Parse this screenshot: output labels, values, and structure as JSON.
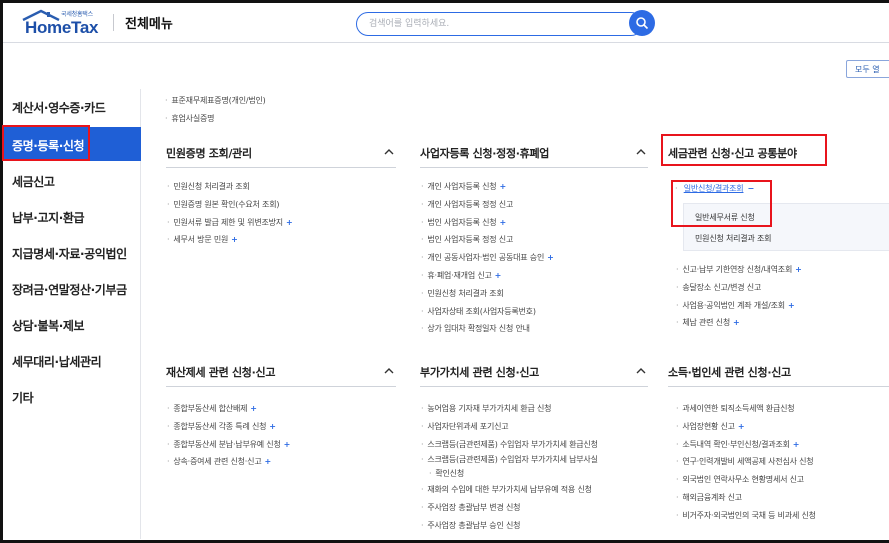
{
  "header": {
    "logo_subtitle": "국세청홈택스",
    "logo_text": "HomeTax",
    "menu_title": "전체메뉴",
    "search_placeholder": "검색어를 입력하세요.",
    "all_button": "모두 열"
  },
  "sidebar": {
    "items": [
      {
        "label": "계산서·영수증·카드"
      },
      {
        "label": "증명·등록·신청"
      },
      {
        "label": "세금신고"
      },
      {
        "label": "납부·고지·환급"
      },
      {
        "label": "지급명세·자료·공익법인"
      },
      {
        "label": "장려금·연말정산·기부금"
      },
      {
        "label": "상담·불복·제보"
      },
      {
        "label": "세무대리·납세관리"
      },
      {
        "label": "기타"
      }
    ],
    "active_index": 1
  },
  "top_items": [
    "표준재무제표증명(개인/법인)",
    "휴업사실증명"
  ],
  "sections": {
    "civil": {
      "title": "민원증명 조회/관리",
      "items": [
        {
          "label": "민원신청 처리결과 조회",
          "plus": ""
        },
        {
          "label": "민원증명 원본 확인(수요처 조회)",
          "plus": ""
        },
        {
          "label": "민원서류 발급 제한 및 위변조방지",
          "plus": "+"
        },
        {
          "label": "세무서 방문 민원",
          "plus": "+"
        }
      ]
    },
    "business": {
      "title": "사업자등록 신청·정정·휴폐업",
      "items": [
        {
          "label": "개인 사업자등록 신청",
          "plus": "+"
        },
        {
          "label": "개인 사업자등록 정정 신고",
          "plus": ""
        },
        {
          "label": "법인 사업자등록 신청",
          "plus": "+"
        },
        {
          "label": "법인 사업자등록 정정 신고",
          "plus": ""
        },
        {
          "label": "개인 공동사업자·법인 공동대표 승인",
          "plus": "+"
        },
        {
          "label": "휴·폐업·재개업 신고",
          "plus": "+"
        },
        {
          "label": "민원신청 처리결과 조회",
          "plus": ""
        },
        {
          "label": "사업자상태 조회(사업자등록번호)",
          "plus": ""
        },
        {
          "label": "상가 임대차 확정일자 신청 안내",
          "plus": ""
        }
      ]
    },
    "common": {
      "title": "세금관련 신청·신고 공통분야",
      "expanded_label": "일반신청/결과조회",
      "expanded_sign": "−",
      "sub_items": [
        "일반세무서류 신청",
        "민원신청 처리결과 조회"
      ],
      "items": [
        {
          "label": "신고·납부 기한연장 신청/내역조회",
          "plus": "+"
        },
        {
          "label": "송달장소 신고/변경 신고",
          "plus": ""
        },
        {
          "label": "사업용·공익법인 계좌 개설/조회",
          "plus": "+"
        },
        {
          "label": "체납 관련 신청",
          "plus": "+"
        }
      ]
    },
    "property": {
      "title": "재산제세 관련 신청·신고",
      "items": [
        {
          "label": "종합부동산세 합산배제",
          "plus": "+"
        },
        {
          "label": "종합부동산세 각종 특례 신청",
          "plus": "+"
        },
        {
          "label": "종합부동산세 분납·납부유예 신청",
          "plus": "+"
        },
        {
          "label": "상속·증여세 관련 신청·신고",
          "plus": "+"
        }
      ]
    },
    "vat": {
      "title": "부가가치세 관련 신청·신고",
      "items": [
        {
          "label": "농어업용 기자재 부가가치세 환급 신청",
          "plus": ""
        },
        {
          "label": "사업자단위과세 포기신고",
          "plus": ""
        },
        {
          "label": "스크랩등(금관련제품) 수입업자 부가가치세 환급신청",
          "plus": ""
        },
        {
          "label": "스크랩등(금관련제품) 수입업자 부가가치세 납부사실",
          "plus": ""
        },
        {
          "label": "확인신청",
          "plus": "",
          "nobullet": true
        },
        {
          "label": "재화의 수입에 대한 부가가치세 납부유예 적용 신청",
          "plus": ""
        },
        {
          "label": "주사업장 총괄납부 변경 신청",
          "plus": ""
        },
        {
          "label": "주사업장 총괄납부 승인 신청",
          "plus": ""
        }
      ]
    },
    "income": {
      "title": "소득·법인세 관련 신청·신고",
      "items": [
        {
          "label": "과세이연한 퇴직소득세액 환급신청",
          "plus": ""
        },
        {
          "label": "사업장현황 신고",
          "plus": "+"
        },
        {
          "label": "소득내역 확인·부인신청/결과조회",
          "plus": "+"
        },
        {
          "label": "연구·인력개발비 세액공제 사전심사 신청",
          "plus": ""
        },
        {
          "label": "외국법인 연락사무소 현황명세서 신고",
          "plus": ""
        },
        {
          "label": "해외금융계좌 신고",
          "plus": ""
        },
        {
          "label": "비거주자·외국법인의 국채 등 비과세 신청",
          "plus": ""
        }
      ]
    }
  },
  "colors": {
    "accent": "#2d6be4",
    "sidebar_active": "#1f5fd6",
    "highlight_box": "#e8141c"
  }
}
